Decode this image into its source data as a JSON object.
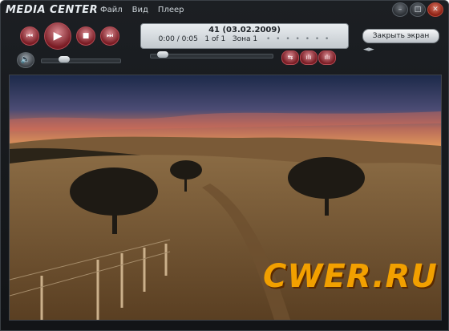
{
  "app": {
    "title": "MEDIA CENTER"
  },
  "menu": {
    "items": [
      "Файл",
      "Вид",
      "Плеер"
    ]
  },
  "window_buttons": {
    "minimize": "–",
    "maximize": "□",
    "close": "✕"
  },
  "transport": {
    "prev": "⏮",
    "play": "▶",
    "stop": "■",
    "next": "⏭"
  },
  "display": {
    "title": "41 (03.02.2009)",
    "time": "0:00 / 0:05",
    "count": "1 of 1",
    "zone": "Зона 1",
    "dots": "• • • • • • •"
  },
  "fullscreen": {
    "label": "Закрыть экран"
  },
  "volume": {
    "level": 0.25
  },
  "progress": {
    "level": 0.05
  },
  "mini_buttons": [
    "⇆",
    "ılı",
    "ılı"
  ],
  "nav_arrows": "◄►",
  "colors": {
    "accent": "#a8323c",
    "frame": "#1c1f23"
  },
  "watermark": {
    "text": "CWER.RU"
  }
}
